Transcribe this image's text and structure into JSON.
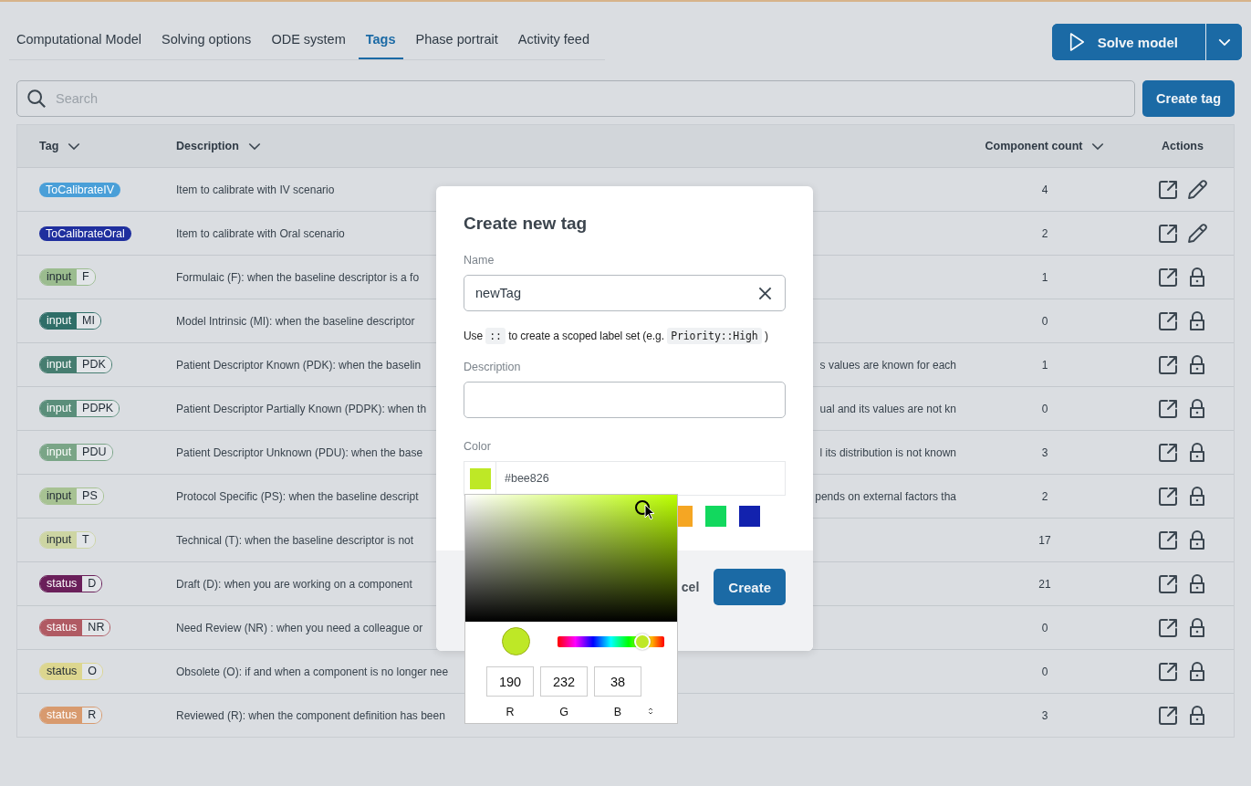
{
  "tabs": [
    {
      "label": "Computational Model",
      "selected": false
    },
    {
      "label": "Solving options",
      "selected": false
    },
    {
      "label": "ODE system",
      "selected": false
    },
    {
      "label": "Tags",
      "selected": true
    },
    {
      "label": "Phase portrait",
      "selected": false
    },
    {
      "label": "Activity feed",
      "selected": false
    }
  ],
  "solve_button": {
    "label": "Solve model"
  },
  "search": {
    "placeholder": "Search"
  },
  "create_tag_button": {
    "label": "Create tag"
  },
  "table": {
    "columns": [
      "Tag",
      "Description",
      "Component count",
      "Actions"
    ],
    "rows": [
      {
        "tag": {
          "kind": "single",
          "name": "ToCalibrateIV",
          "color": "#4a9fd8"
        },
        "description": "Item to calibrate with IV scenario",
        "count": "4",
        "locked": false
      },
      {
        "tag": {
          "kind": "single",
          "name": "ToCalibrateOral",
          "color": "#1f2f9e"
        },
        "description": "Item to calibrate with Oral scenario",
        "count": "2",
        "locked": false
      },
      {
        "tag": {
          "kind": "scoped",
          "scope": "input",
          "value": "F",
          "color": "#9bbc8f"
        },
        "description": "Formulaic (F): when the baseline descriptor is a fo",
        "count": "1",
        "locked": true
      },
      {
        "tag": {
          "kind": "scoped",
          "scope": "input",
          "value": "MI",
          "color": "#2f6e68"
        },
        "description": "Model Intrinsic (MI): when the baseline descriptor",
        "count": "0",
        "locked": true
      },
      {
        "tag": {
          "kind": "scoped",
          "scope": "input",
          "value": "PDK",
          "color": "#467d70"
        },
        "description": "Patient Descriptor Known (PDK): when the baselin",
        "description_end": "s values are known for each",
        "count": "1",
        "locked": true
      },
      {
        "tag": {
          "kind": "scoped",
          "scope": "input",
          "value": "PDPK",
          "color": "#5a8e7a"
        },
        "description": "Patient Descriptor Partially Known (PDPK): when th",
        "description_end": "ual and its values are not kn",
        "count": "0",
        "locked": true
      },
      {
        "tag": {
          "kind": "scoped",
          "scope": "input",
          "value": "PDU",
          "color": "#7aa587"
        },
        "description": "Patient Descriptor Unknown (PDU): when the base",
        "description_end": "l its distribution is not known",
        "count": "3",
        "locked": true
      },
      {
        "tag": {
          "kind": "scoped",
          "scope": "input",
          "value": "PS",
          "color": "#a7c293"
        },
        "description": "Protocol Specific (PS): when the baseline descript",
        "description_end": "pends on external factors tha",
        "count": "2",
        "locked": true
      },
      {
        "tag": {
          "kind": "scoped",
          "scope": "input",
          "value": "T",
          "color": "#cdd5a3"
        },
        "description": "Technical (T): when the baseline descriptor is not",
        "count": "17",
        "locked": true
      },
      {
        "tag": {
          "kind": "scoped",
          "scope": "status",
          "value": "D",
          "color": "#6a1f5a"
        },
        "description": "Draft (D): when you are working on a component",
        "count": "21",
        "locked": true
      },
      {
        "tag": {
          "kind": "scoped",
          "scope": "status",
          "value": "NR",
          "color": "#b05a63"
        },
        "description": "Need Review (NR) : when you need a colleague or",
        "count": "0",
        "locked": true
      },
      {
        "tag": {
          "kind": "scoped",
          "scope": "status",
          "value": "O",
          "color": "#dcd68f"
        },
        "description": "Obsolete (O): if and when a component is no longer nee",
        "count": "0",
        "locked": true
      },
      {
        "tag": {
          "kind": "scoped",
          "scope": "status",
          "value": "R",
          "color": "#d89a6e"
        },
        "description": "Reviewed (R): when the component definition has been",
        "count": "3",
        "locked": true
      }
    ]
  },
  "dialog": {
    "title": "Create new tag",
    "name_label": "Name",
    "name_value": "newTag",
    "hint": [
      {
        "kind": "text",
        "text": "Use"
      },
      {
        "kind": "code",
        "text": "::"
      },
      {
        "kind": "text",
        "text": "to create a scoped label set (e.g."
      },
      {
        "kind": "code",
        "text": "Priority::High"
      },
      {
        "kind": "text",
        "text": ")"
      }
    ],
    "description_label": "Description",
    "color_label": "Color",
    "color_value": "#bee826",
    "presets": [
      {
        "color": "#f5a623"
      },
      {
        "color": "#12d85e"
      },
      {
        "color": "#1222ae"
      }
    ],
    "cancel_button": {
      "label": "cel"
    },
    "create_button": {
      "label": "Create"
    }
  },
  "picker": {
    "hue": {
      "level": 0.79
    },
    "rgb": [
      {
        "label": "R",
        "value": "190"
      },
      {
        "label": "G",
        "value": "232"
      },
      {
        "label": "B",
        "value": "38"
      }
    ]
  }
}
